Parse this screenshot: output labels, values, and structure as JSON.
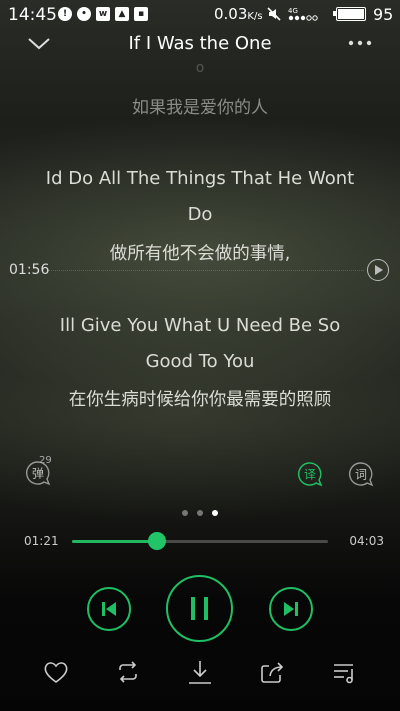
{
  "status_bar": {
    "time": "14:45",
    "speed": "0.03",
    "speed_unit": "K/s",
    "network": "4G",
    "battery": "95"
  },
  "header": {
    "title": "If I Was the One"
  },
  "lyrics": {
    "prev_fragment": "o",
    "previous_line_zh": "如果我是爱你的人",
    "current_en": [
      "Id Do All The Things That He Wont",
      "Do"
    ],
    "current_zh": "做所有他不会做的事情,",
    "next_en": [
      "Ill Give You What U Need Be So",
      "Good To You"
    ],
    "next_zh": "在你生病时候给你你最需要的照顾"
  },
  "lyric_seek": {
    "time": "01:56"
  },
  "side_buttons": {
    "danmaku_label": "弹",
    "danmaku_count": "29",
    "translate_label": "译",
    "words_label": "词"
  },
  "pager": {
    "count": 3,
    "active_index": 2
  },
  "playback": {
    "current_time": "01:21",
    "total_time": "04:03",
    "progress_fraction": 0.3333
  },
  "colors": {
    "accent": "#1fbf63",
    "background": "#0b0c0a"
  },
  "icons": {
    "collapse": "chevron-down-icon",
    "more": "more-dots-icon",
    "prev": "skip-previous-icon",
    "pause": "pause-icon",
    "next": "skip-next-icon",
    "like": "heart-icon",
    "repeat": "repeat-icon",
    "download": "download-icon",
    "share": "share-icon",
    "playlist": "playlist-icon"
  }
}
